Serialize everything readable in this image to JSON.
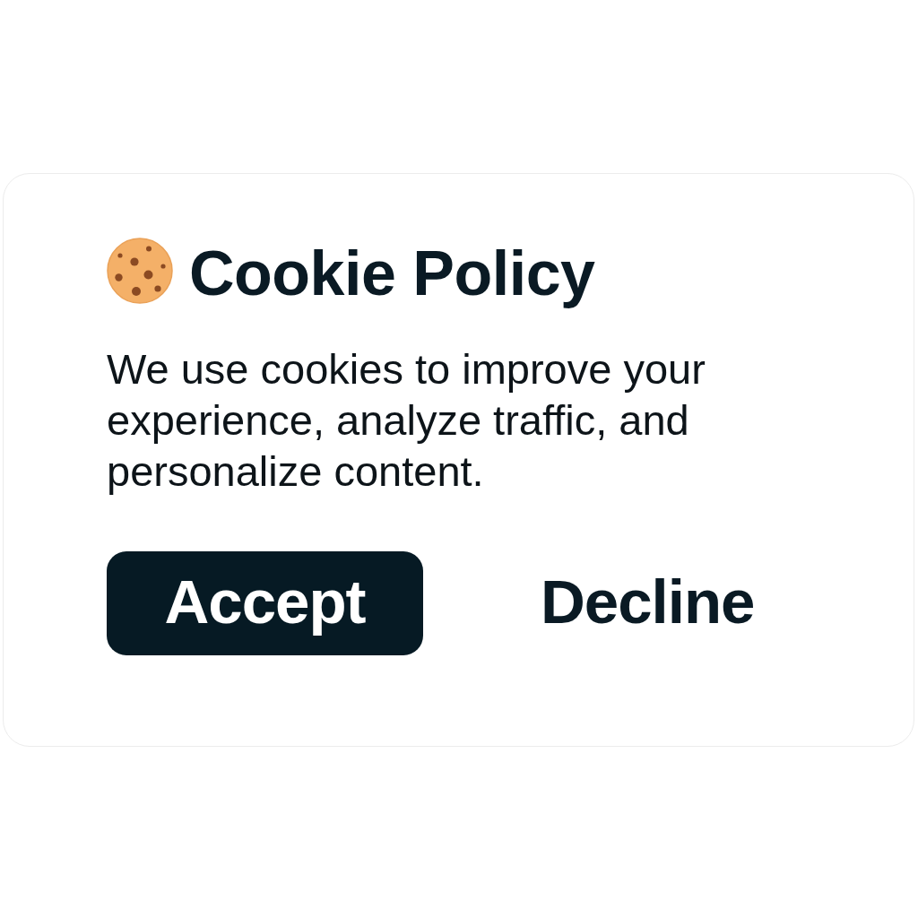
{
  "dialog": {
    "title": "Cookie Policy",
    "message": "We use cookies to improve your experience, analyze traffic, and personalize content.",
    "buttons": [
      {
        "label": "Accept",
        "kind": "primary"
      },
      {
        "label": "Decline",
        "kind": "text"
      }
    ]
  }
}
